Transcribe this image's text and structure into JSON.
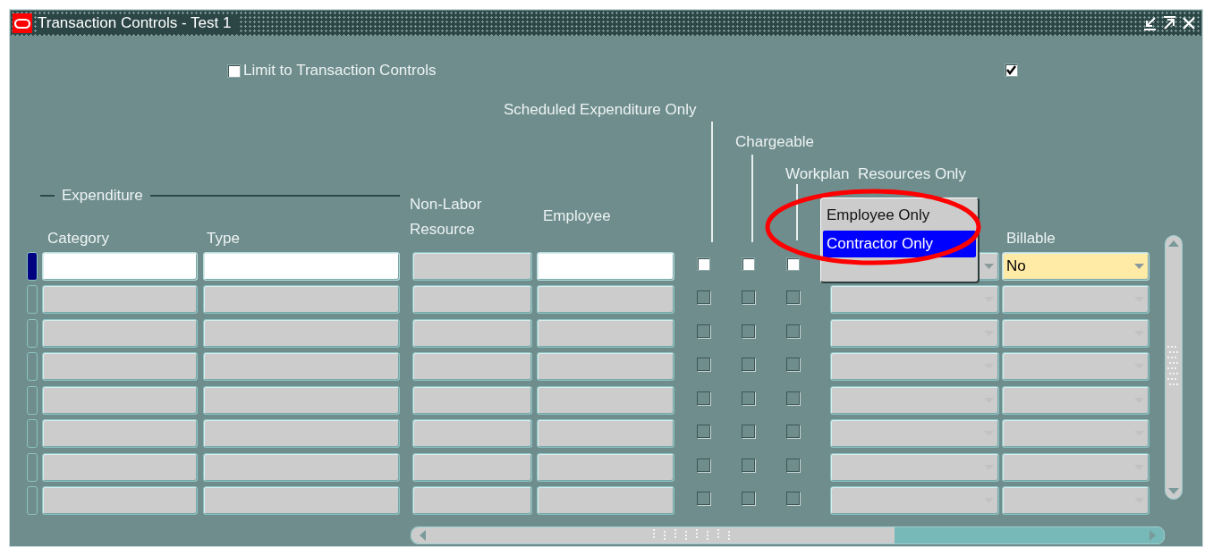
{
  "window": {
    "title": "Transaction Controls - Test 1"
  },
  "limit_to_transaction_controls": {
    "label": "Limit to Transaction Controls",
    "checked": false
  },
  "unlabeled_checkbox": {
    "checked": true
  },
  "headers": {
    "expenditure_group": "Expenditure",
    "category": "Category",
    "type": "Type",
    "non_labor_resource": "Non-Labor Resource",
    "employee": "Employee",
    "scheduled_expenditure_only": "Scheduled Expenditure Only",
    "chargeable": "Chargeable",
    "workplan_resources_only": "Workplan  Resources Only",
    "billable": "Billable"
  },
  "rows": [
    {
      "selected": true,
      "scheduled_expenditure_only": false,
      "chargeable": false,
      "workplan_resources_only": false,
      "billable": "No"
    },
    {
      "selected": false,
      "scheduled_expenditure_only": false,
      "chargeable": false,
      "workplan_resources_only": false
    },
    {
      "selected": false,
      "scheduled_expenditure_only": false,
      "chargeable": false,
      "workplan_resources_only": false
    },
    {
      "selected": false,
      "scheduled_expenditure_only": false,
      "chargeable": false,
      "workplan_resources_only": false
    },
    {
      "selected": false,
      "scheduled_expenditure_only": false,
      "chargeable": false,
      "workplan_resources_only": false
    },
    {
      "selected": false,
      "scheduled_expenditure_only": false,
      "chargeable": false,
      "workplan_resources_only": false
    },
    {
      "selected": false,
      "scheduled_expenditure_only": false,
      "chargeable": false,
      "workplan_resources_only": false
    },
    {
      "selected": false,
      "scheduled_expenditure_only": false,
      "chargeable": false,
      "workplan_resources_only": false
    }
  ],
  "resource_type_dropdown": {
    "options": [
      {
        "label": "Employee Only",
        "selected": false
      },
      {
        "label": "Contractor Only",
        "selected": true
      }
    ]
  }
}
